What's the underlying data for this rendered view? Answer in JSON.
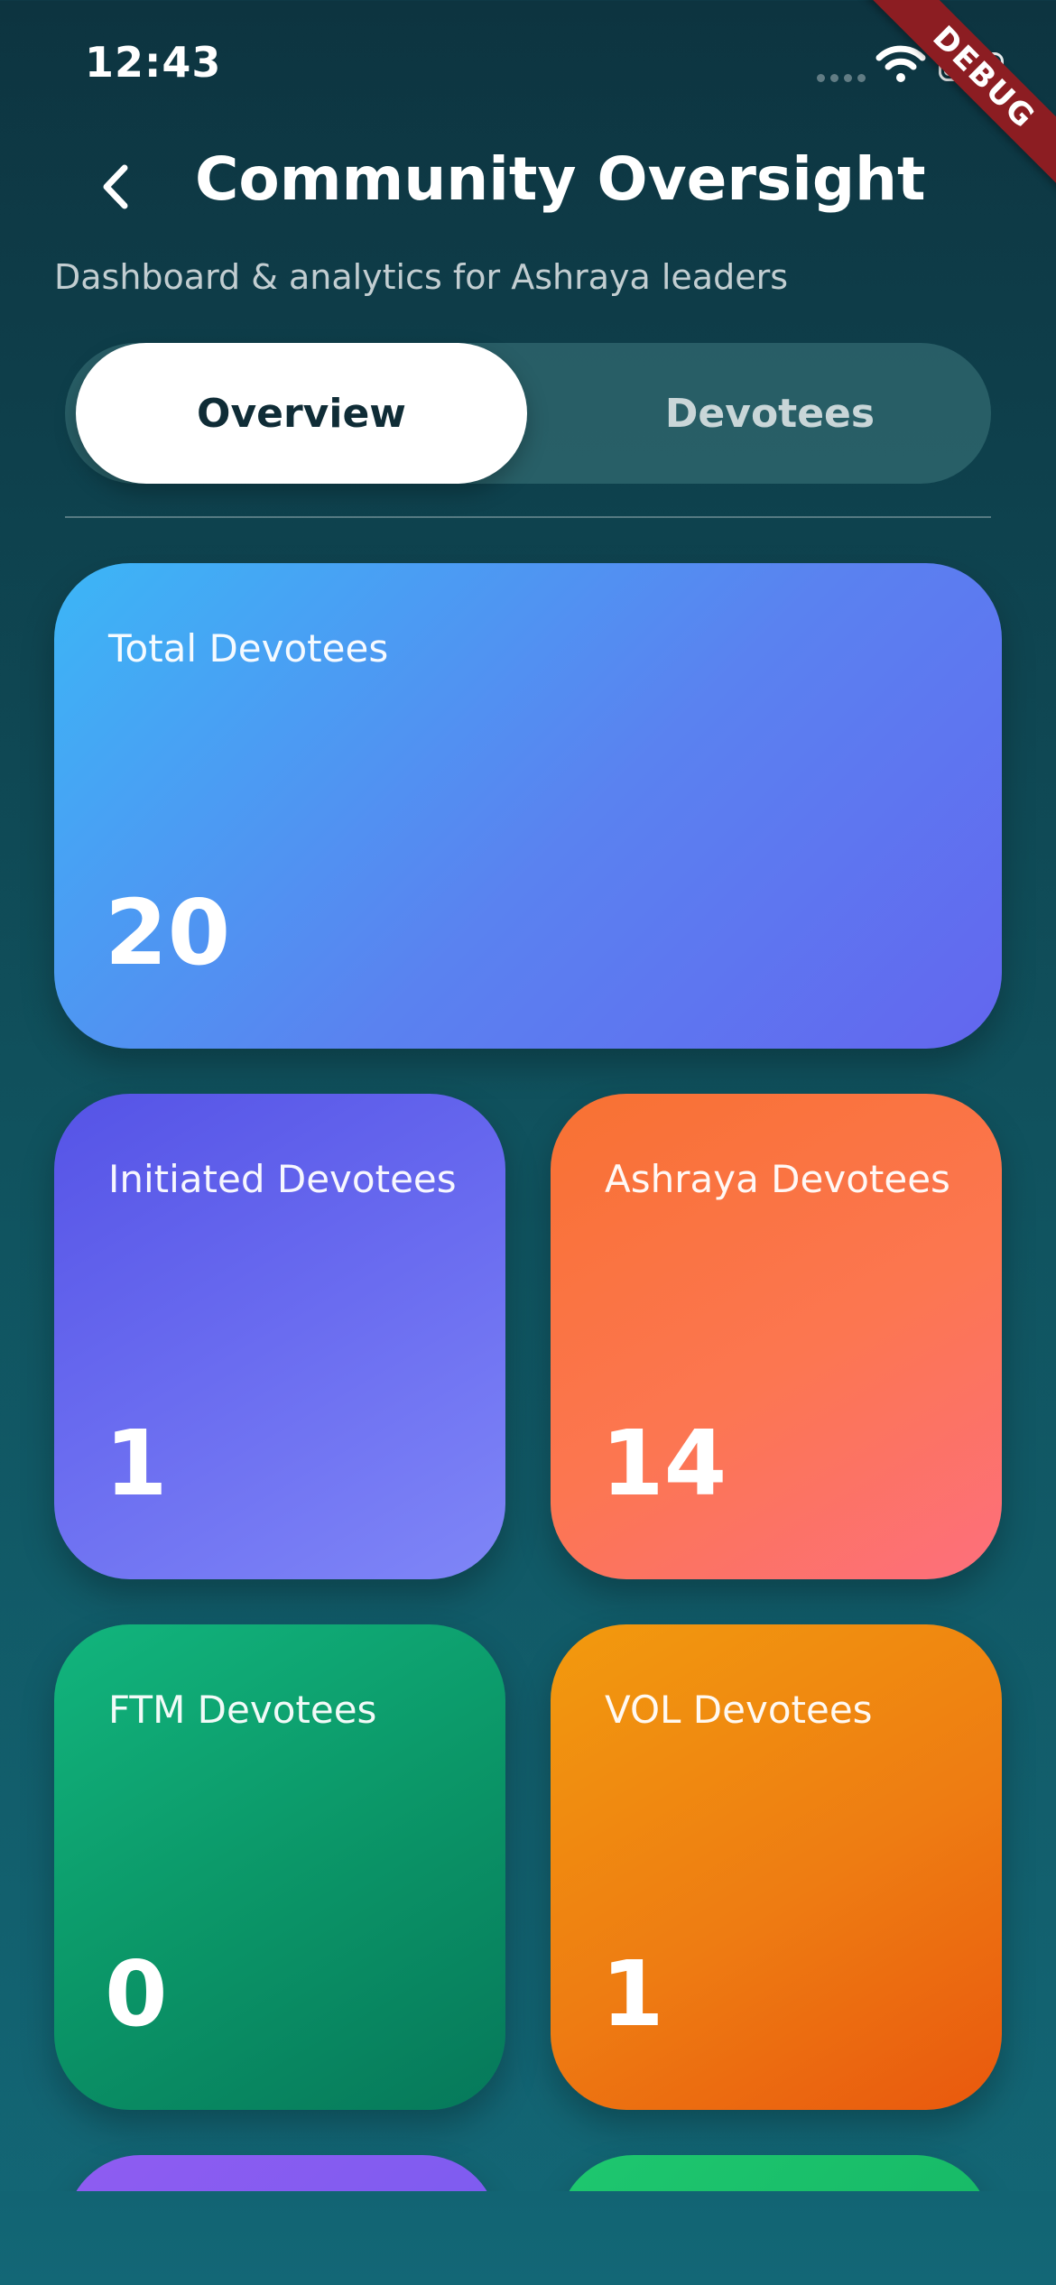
{
  "status_bar": {
    "time": "12:43"
  },
  "debug_banner": "DEBUG",
  "header": {
    "title": "Community Oversight",
    "subtitle": "Dashboard & analytics for Ashraya leaders"
  },
  "tabs": [
    {
      "label": "Overview",
      "selected": true
    },
    {
      "label": "Devotees",
      "selected": false
    }
  ],
  "stats": {
    "total": {
      "label": "Total Devotees",
      "value": "20"
    },
    "initiated": {
      "label": "Initiated Devotees",
      "value": "1"
    },
    "ashraya": {
      "label": "Ashraya Devotees",
      "value": "14"
    },
    "ftm": {
      "label": "FTM Devotees",
      "value": "0"
    },
    "vol": {
      "label": "VOL Devotees",
      "value": "1"
    }
  },
  "colors": {
    "background": "#10525e",
    "total_card": "#4f92f3",
    "initiated_card": "#6a6cf0",
    "ashraya_card": "#fc7651",
    "ftm_card": "#0b9768",
    "vol_card": "#ee7c12",
    "debug_ribbon": "#8c1d22"
  }
}
